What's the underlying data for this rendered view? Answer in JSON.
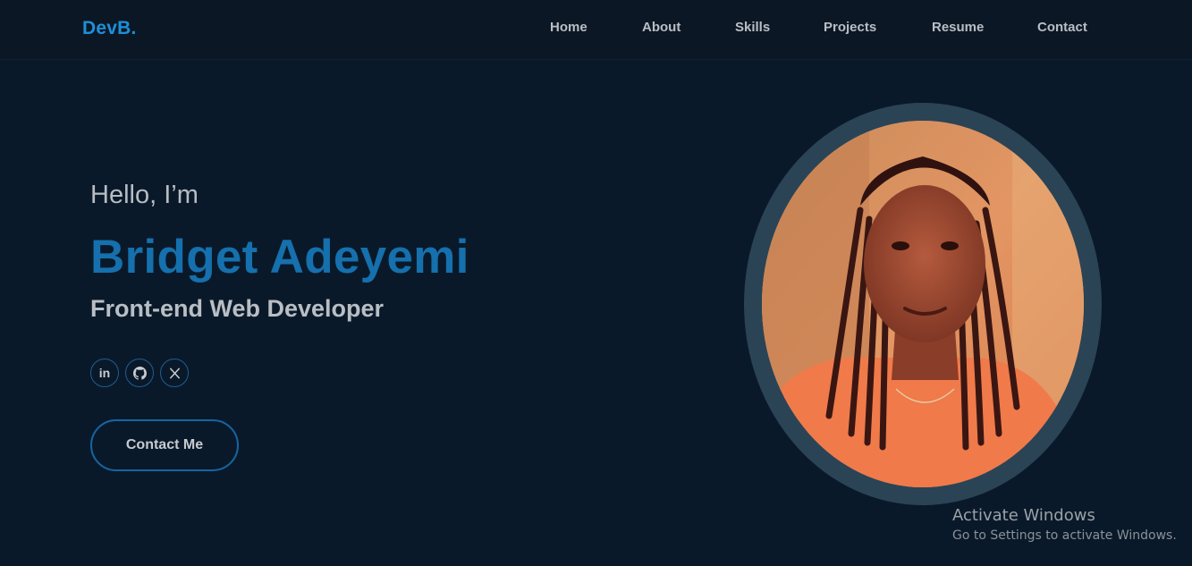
{
  "nav": {
    "logo": "DevB.",
    "links": [
      "Home",
      "About",
      "Skills",
      "Projects",
      "Resume",
      "Contact"
    ]
  },
  "hero": {
    "greeting": "Hello, I’m",
    "name": "Bridget Adeyemi",
    "role": "Front-end Web Developer",
    "socials": [
      "linkedin-icon",
      "github-icon",
      "x-twitter-icon"
    ],
    "cta": "Contact Me"
  },
  "watermark": {
    "title": "Activate Windows",
    "subtitle": "Go to Settings to activate Windows."
  },
  "colors": {
    "background": "#0a1929",
    "accent": "#1570ad",
    "logo": "#1e8fd8",
    "ring": "#2a4456"
  }
}
